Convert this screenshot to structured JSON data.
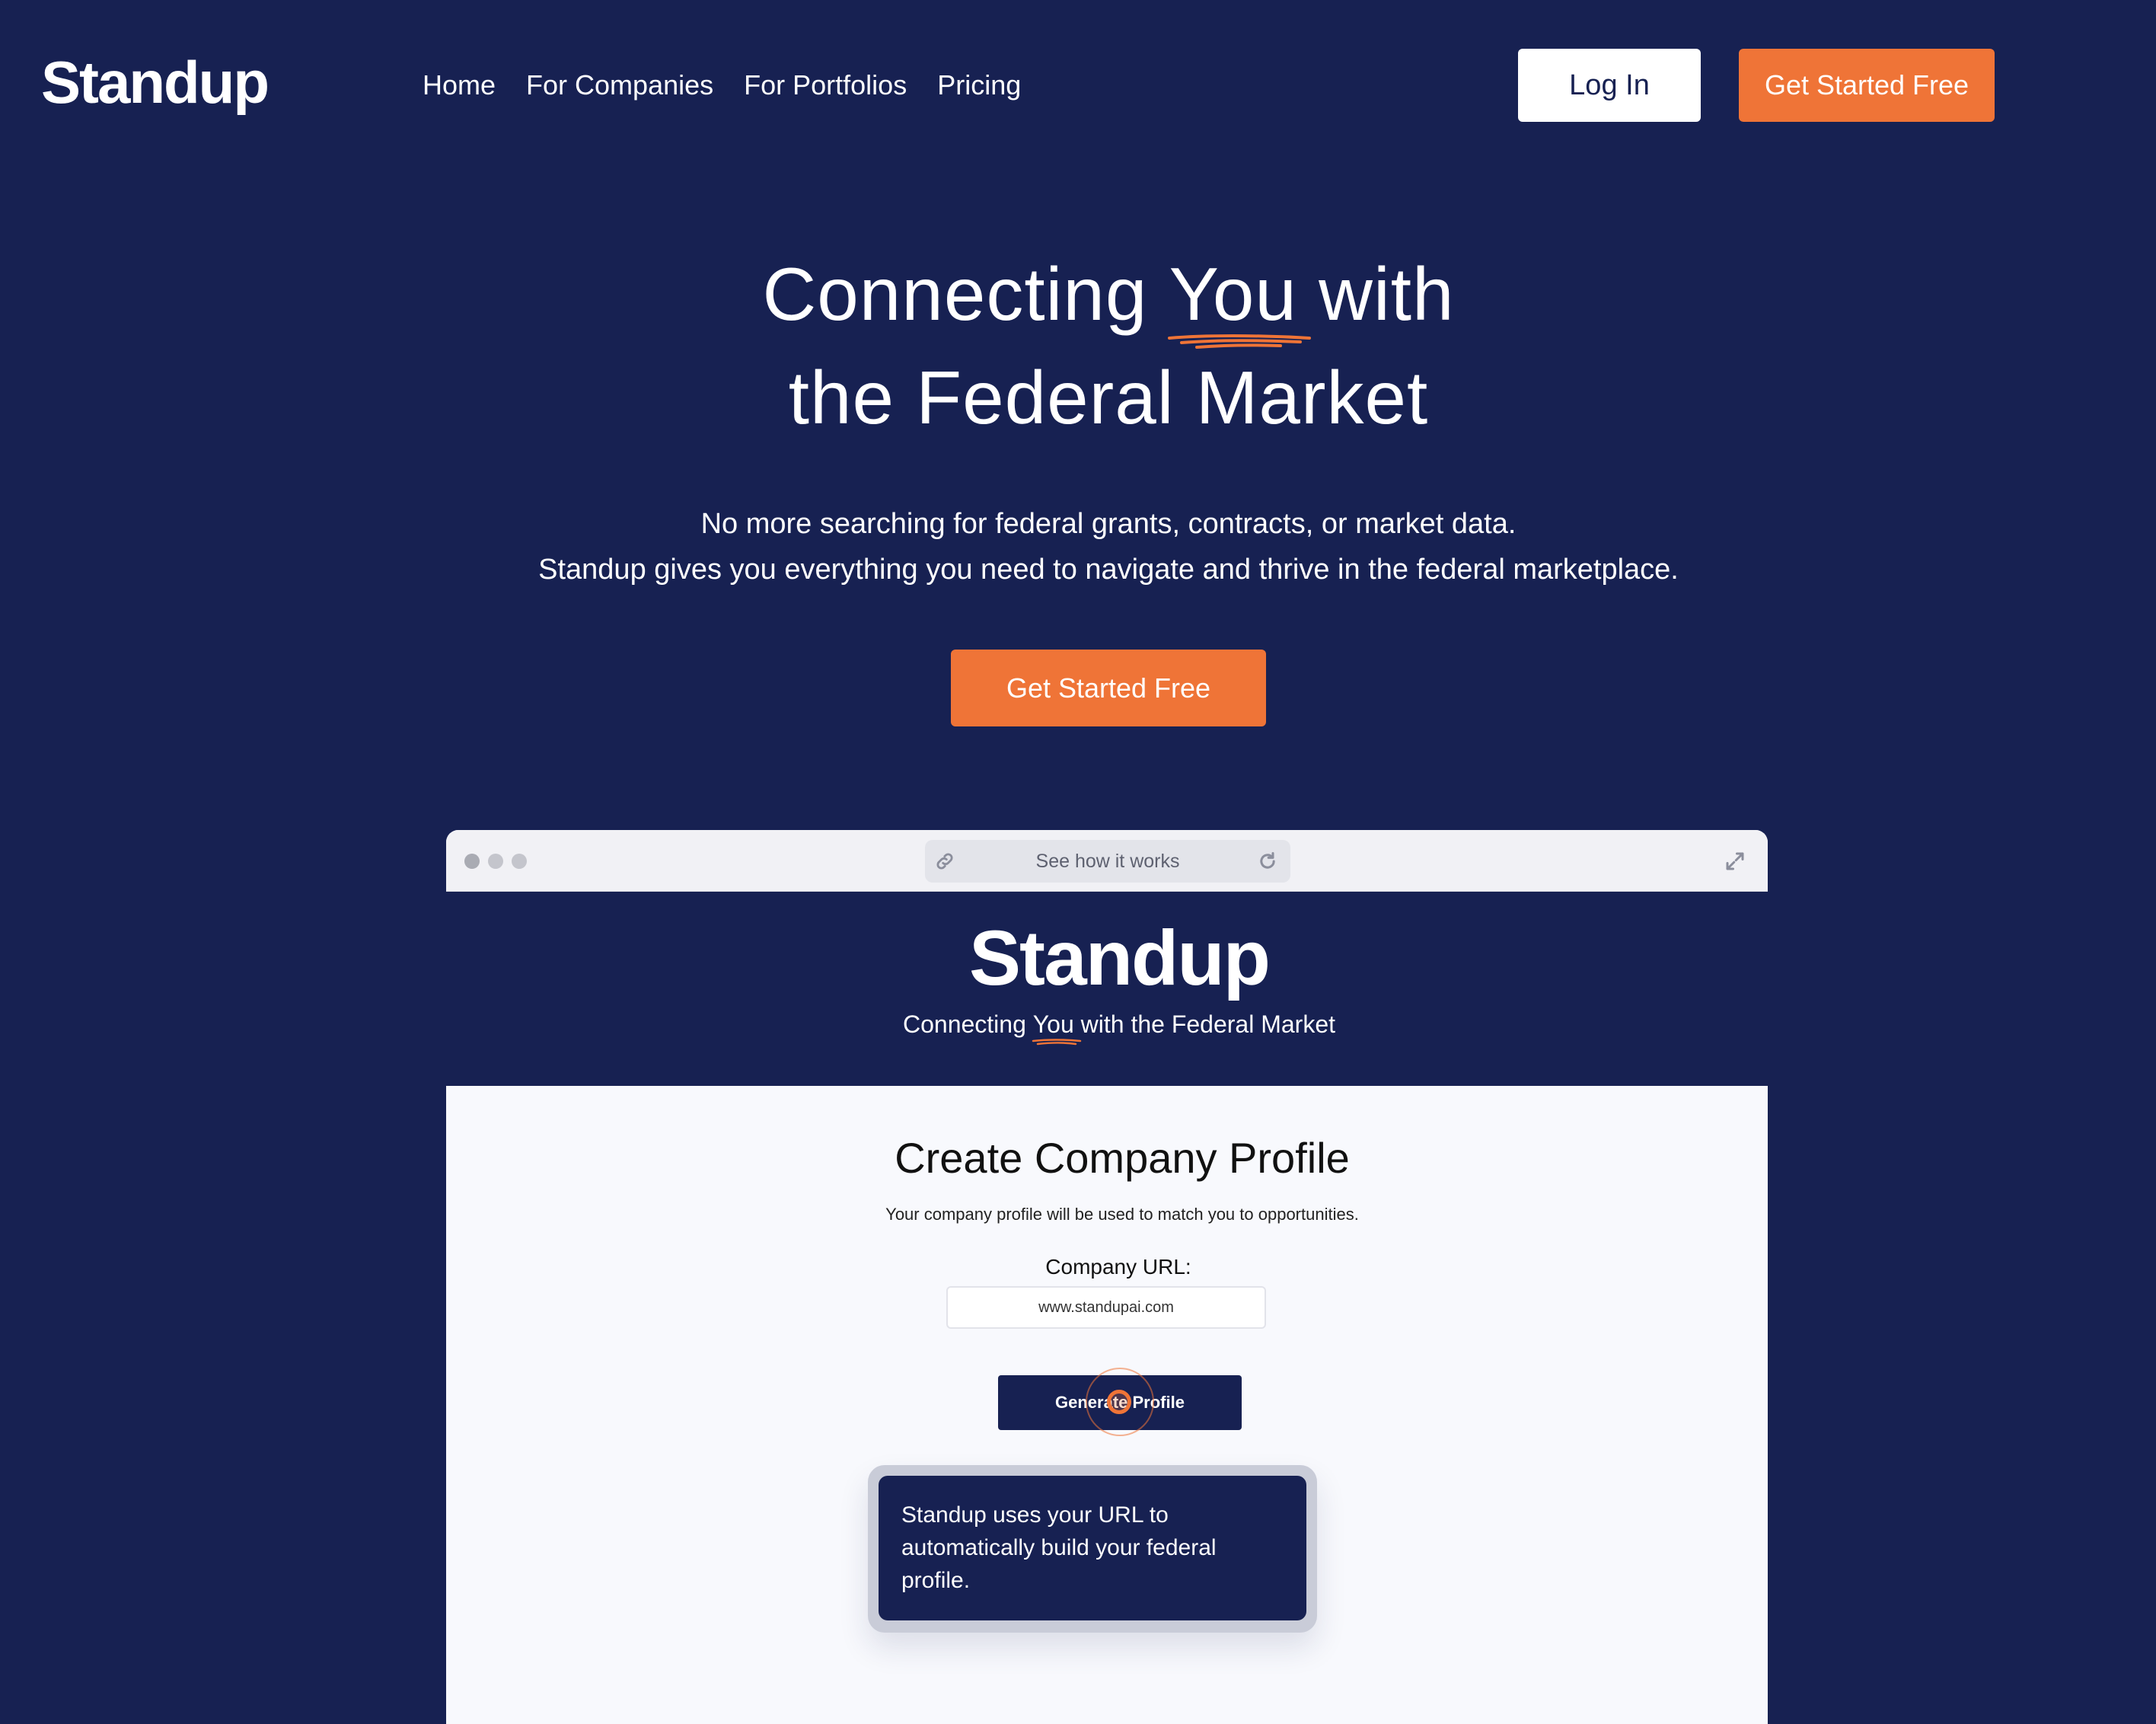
{
  "brand": {
    "logo": "Standup"
  },
  "nav": {
    "items": [
      "Home",
      "For Companies",
      "For Portfolios",
      "Pricing"
    ]
  },
  "header_actions": {
    "login": "Log In",
    "get_started": "Get Started Free"
  },
  "hero": {
    "title_part1": "Connecting ",
    "title_highlight": "You",
    "title_part2": " with",
    "title_line2": "the Federal Market",
    "subtitle_line1": "No more searching for federal grants, contracts, or market data.",
    "subtitle_line2": "Standup gives you everything you need to navigate and thrive in the federal marketplace.",
    "cta": "Get Started Free"
  },
  "demo": {
    "address_bar": "See how it works",
    "inner_logo": "Standup",
    "tagline_part1": "Connecting ",
    "tagline_highlight": "You",
    "tagline_part2": " with the Federal Market",
    "form_title": "Create Company Profile",
    "form_description": "Your company profile will be used to match you to opportunities.",
    "url_label": "Company URL:",
    "url_value": "www.standupai.com",
    "generate_button": "Generate Profile",
    "tooltip": "Standup uses your URL to automatically build your federal profile."
  },
  "colors": {
    "navy": "#172152",
    "accent_orange": "#ef7437",
    "white": "#ffffff",
    "panel_bg": "#f8f9fd"
  },
  "icons": [
    "link-icon",
    "reload-icon",
    "expand-icon",
    "window-dot-icon"
  ]
}
